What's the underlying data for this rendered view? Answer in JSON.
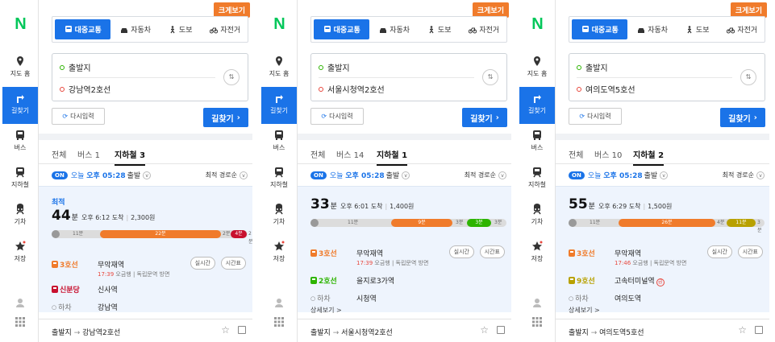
{
  "common": {
    "logo": "N",
    "big_view": "크게보기",
    "modes": [
      "대중교통",
      "자동차",
      "도보",
      "자전거"
    ],
    "rail": [
      "지도 홈",
      "길찾기",
      "버스",
      "지하철",
      "기차",
      "저장"
    ],
    "origin": "출발지",
    "reset": "다시입력",
    "go": "길찾기",
    "swap": "⇅",
    "tab_all": "전체",
    "on": "ON",
    "today": "오늘",
    "sort": "최적 경로순",
    "departure_suffix": "출발",
    "arrow": "→",
    "colors": {
      "naver_green": "#03c75a",
      "accent_blue": "#1a73e8",
      "line3_orange": "#f07b2b",
      "line2_green": "#2db400",
      "line9_gold": "#b8a100",
      "sinbundang_red": "#c8102e"
    }
  },
  "panels": [
    {
      "destination": "강남역2호선",
      "tabs": [
        "버스 1",
        "지하철 3"
      ],
      "departure": "오후 05:28",
      "best_label": "최적",
      "total_min": "44",
      "arrive": "오후 6:12 도착",
      "fare": "2,300원",
      "bar_labels": [
        "11분",
        "22분",
        "2분",
        "4분",
        "2분"
      ],
      "steps": [
        {
          "line": "3호선",
          "station": "무악재역",
          "time": "17:39",
          "detail": "오금행 | 독립문역 방면",
          "btn1": "실시간",
          "btn2": "시간표"
        },
        {
          "line": "신분당",
          "station": "신사역"
        },
        {
          "line": "하차",
          "station": "강남역"
        }
      ],
      "more": ""
    },
    {
      "destination": "서울시청역2호선",
      "tabs": [
        "버스 14",
        "지하철 1"
      ],
      "departure": "오후 05:28",
      "best_label": "",
      "total_min": "33",
      "arrive": "오후 6:01 도착",
      "fare": "1,400원",
      "bar_labels": [
        "11분",
        "9분",
        "3분",
        "3분",
        "3분"
      ],
      "steps": [
        {
          "line": "3호선",
          "station": "무악재역",
          "time": "17:39",
          "detail": "오금행 | 독립문역 방면",
          "btn1": "실시간",
          "btn2": "시간표"
        },
        {
          "line": "2호선",
          "station": "을지로3가역"
        },
        {
          "line": "하차",
          "station": "시청역"
        }
      ],
      "more": "상세보기 >"
    },
    {
      "destination": "여의도역5호선",
      "tabs": [
        "버스 10",
        "지하철 2"
      ],
      "departure": "오후 05:28",
      "best_label": "",
      "total_min": "55",
      "arrive": "오후 6:29 도착",
      "fare": "1,500원",
      "bar_labels": [
        "11분",
        "26분",
        "4분",
        "11분",
        "3분"
      ],
      "steps": [
        {
          "line": "3호선",
          "station": "무악재역",
          "time": "17:46",
          "detail": "오금행 | 독립문역 방면",
          "btn1": "실시간",
          "btn2": "시간표"
        },
        {
          "line": "9호선",
          "station": "고속터미널역",
          "badge": "급"
        },
        {
          "line": "하차",
          "station": "여의도역"
        }
      ],
      "more": "상세보기 >"
    }
  ]
}
